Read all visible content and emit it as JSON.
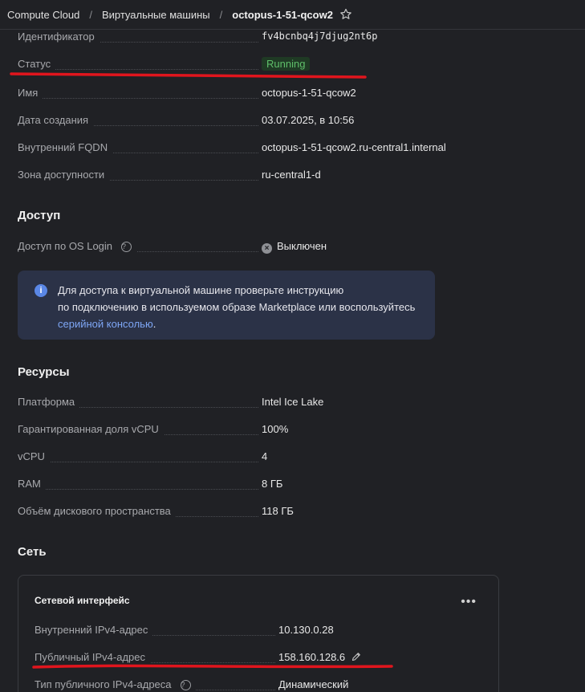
{
  "breadcrumb": {
    "items": [
      "Compute Cloud",
      "Виртуальные машины",
      "octopus-1-51-qcow2"
    ],
    "separator": "/"
  },
  "overview": {
    "id_label": "Идентификатор",
    "id_value": "fv4bcnbq4j7djug2nt6p",
    "status_label": "Статус",
    "status_value": "Running",
    "name_label": "Имя",
    "name_value": "octopus-1-51-qcow2",
    "created_label": "Дата создания",
    "created_value": "03.07.2025, в 10:56",
    "fqdn_label": "Внутренний FQDN",
    "fqdn_value": "octopus-1-51-qcow2.ru-central1.internal",
    "zone_label": "Зона доступности",
    "zone_value": "ru-central1-d"
  },
  "access": {
    "title": "Доступ",
    "oslogin_label": "Доступ по OS Login",
    "oslogin_value": "Выключен",
    "info_line1": "Для доступа к виртуальной машине проверьте инструкцию",
    "info_line2": "по подключению в используемом образе Marketplace или воспользуйтесь",
    "info_link": "серийной консолью",
    "info_end": "."
  },
  "resources": {
    "title": "Ресурсы",
    "platform_label": "Платформа",
    "platform_value": "Intel Ice Lake",
    "vcpu_share_label": "Гарантированная доля vCPU",
    "vcpu_share_value": "100%",
    "vcpu_label": "vCPU",
    "vcpu_value": "4",
    "ram_label": "RAM",
    "ram_value": "8 ГБ",
    "disk_label": "Объём дискового пространства",
    "disk_value": "118 ГБ"
  },
  "network": {
    "title": "Сеть",
    "card_title": "Сетевой интерфейс",
    "menu": "•••",
    "internal_ip_label": "Внутренний IPv4-адрес",
    "internal_ip_value": "10.130.0.28",
    "public_ip_label": "Публичный IPv4-адрес",
    "public_ip_value": "158.160.128.6",
    "public_type_label": "Тип публичного IPv4-адреса",
    "public_type_value": "Динамический"
  },
  "colors": {
    "background": "#202125",
    "status_green": "#5fbf6a",
    "link": "#7ea6f5",
    "annotation_red": "#e0151d"
  }
}
